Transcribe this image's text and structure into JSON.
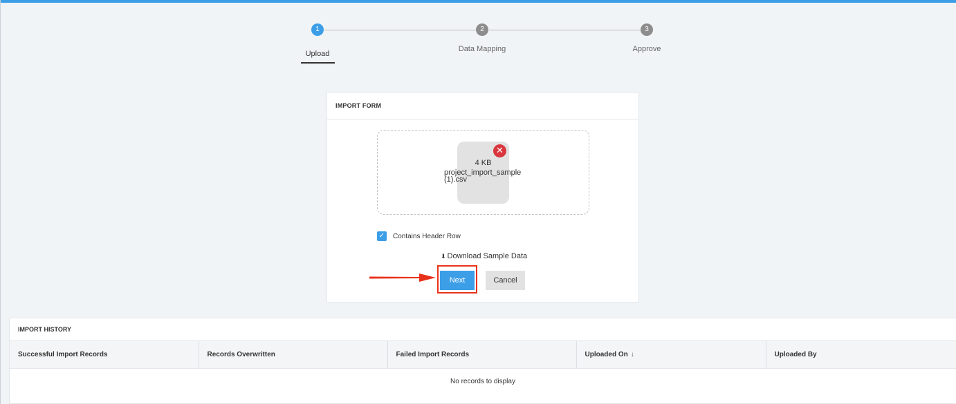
{
  "stepper": {
    "steps": [
      {
        "number": "1",
        "label": "Upload",
        "active": true
      },
      {
        "number": "2",
        "label": "Data Mapping",
        "active": false
      },
      {
        "number": "3",
        "label": "Approve",
        "active": false
      }
    ]
  },
  "import_form": {
    "title": "IMPORT FORM",
    "file": {
      "size": "4 KB",
      "name": "project_import_sample (1).csv",
      "remove_icon": "close-circle-icon"
    },
    "contains_header_row": {
      "label": "Contains Header Row",
      "checked": true
    },
    "download_sample": {
      "label": "Download Sample Data",
      "icon": "download-icon"
    },
    "next_label": "Next",
    "cancel_label": "Cancel"
  },
  "import_history": {
    "title": "IMPORT HISTORY",
    "columns": [
      "Successful Import Records",
      "Records Overwritten",
      "Failed Import Records",
      "Uploaded On",
      "Uploaded By"
    ],
    "empty_message": "No records to display"
  },
  "colors": {
    "accent": "#3d9ee8",
    "highlight": "#e8311a",
    "remove": "#d9363e"
  }
}
